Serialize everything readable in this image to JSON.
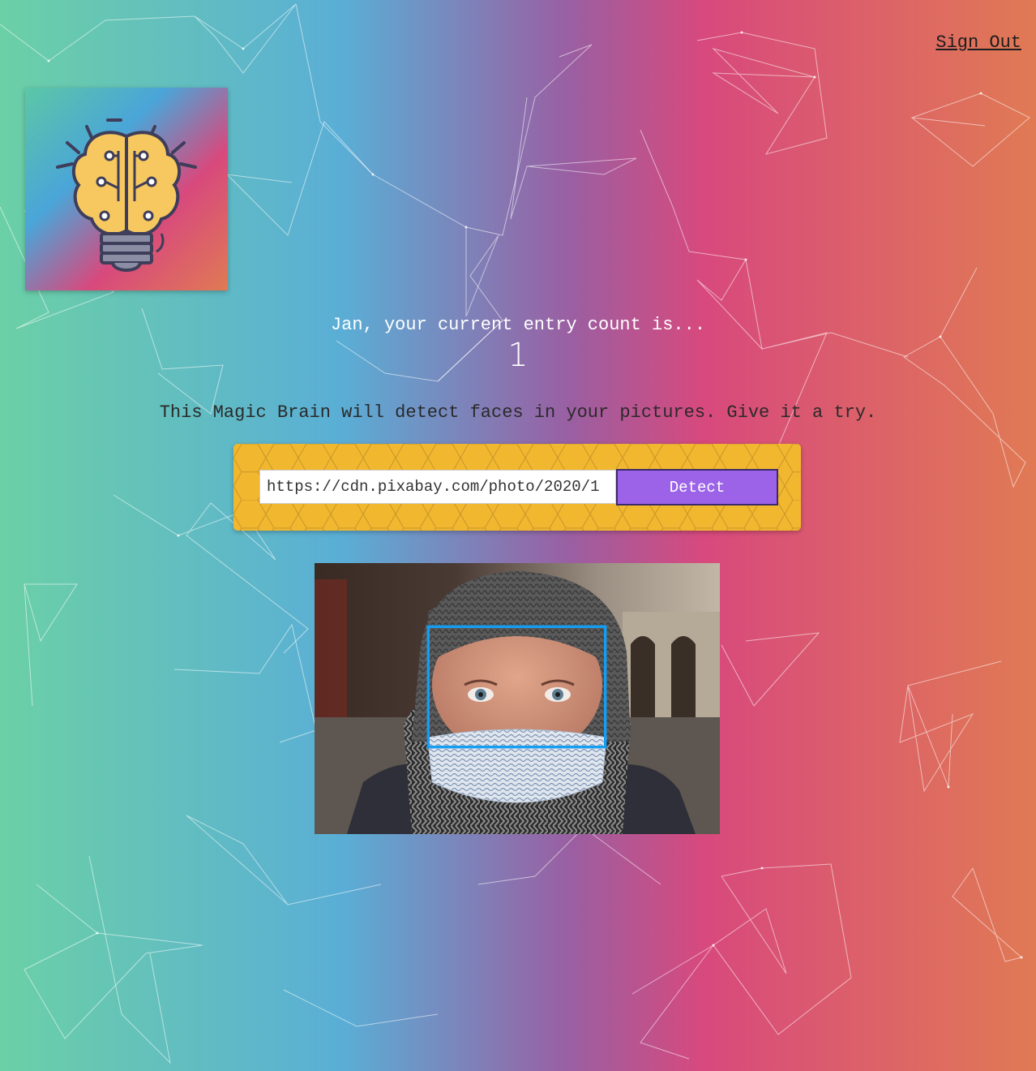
{
  "nav": {
    "sign_out_label": "Sign Out"
  },
  "logo": {
    "icon": "brain-lightbulb-icon"
  },
  "rank": {
    "text": "Jan, your current entry count is...",
    "count": "1"
  },
  "tagline": "This Magic Brain will detect faces in your pictures. Give it a try.",
  "form": {
    "url_value": "https://cdn.pixabay.com/photo/2020/1",
    "detect_label": "Detect"
  },
  "image": {
    "subject": "child-with-knit-hat-and-face-mask",
    "face_boxes": 1
  },
  "colors": {
    "gradient_left": "#6bd0a6",
    "gradient_mid": "#d8497d",
    "gradient_right": "#e07a54",
    "panel_yellow": "#f0b72f",
    "button_purple": "#9c63e8",
    "face_box_blue": "#149df2"
  }
}
